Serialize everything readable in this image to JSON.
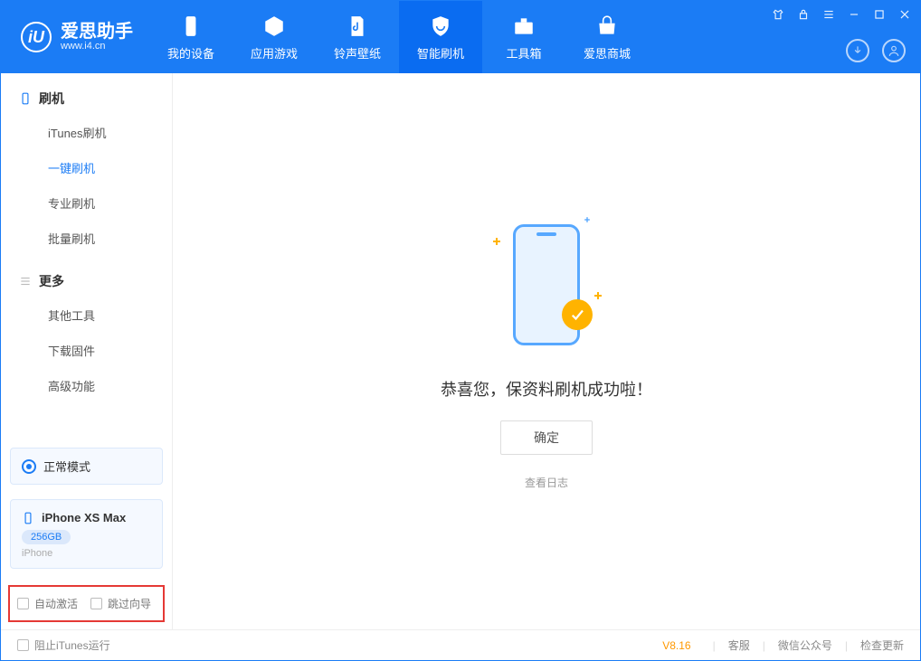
{
  "app": {
    "title": "爱思助手",
    "subtitle": "www.i4.cn"
  },
  "nav": {
    "items": [
      {
        "label": "我的设备"
      },
      {
        "label": "应用游戏"
      },
      {
        "label": "铃声壁纸"
      },
      {
        "label": "智能刷机"
      },
      {
        "label": "工具箱"
      },
      {
        "label": "爱思商城"
      }
    ]
  },
  "sidebar": {
    "group1": {
      "title": "刷机",
      "items": [
        {
          "label": "iTunes刷机"
        },
        {
          "label": "一键刷机"
        },
        {
          "label": "专业刷机"
        },
        {
          "label": "批量刷机"
        }
      ]
    },
    "group2": {
      "title": "更多",
      "items": [
        {
          "label": "其他工具"
        },
        {
          "label": "下载固件"
        },
        {
          "label": "高级功能"
        }
      ]
    },
    "mode": "正常模式",
    "device": {
      "name": "iPhone XS Max",
      "capacity": "256GB",
      "type": "iPhone"
    },
    "options": {
      "auto_activate": "自动激活",
      "skip_guide": "跳过向导"
    }
  },
  "main": {
    "success_text": "恭喜您，保资料刷机成功啦！",
    "ok_button": "确定",
    "log_link": "查看日志"
  },
  "footer": {
    "block_itunes": "阻止iTunes运行",
    "version": "V8.16",
    "links": {
      "service": "客服",
      "wechat": "微信公众号",
      "update": "检查更新"
    }
  }
}
